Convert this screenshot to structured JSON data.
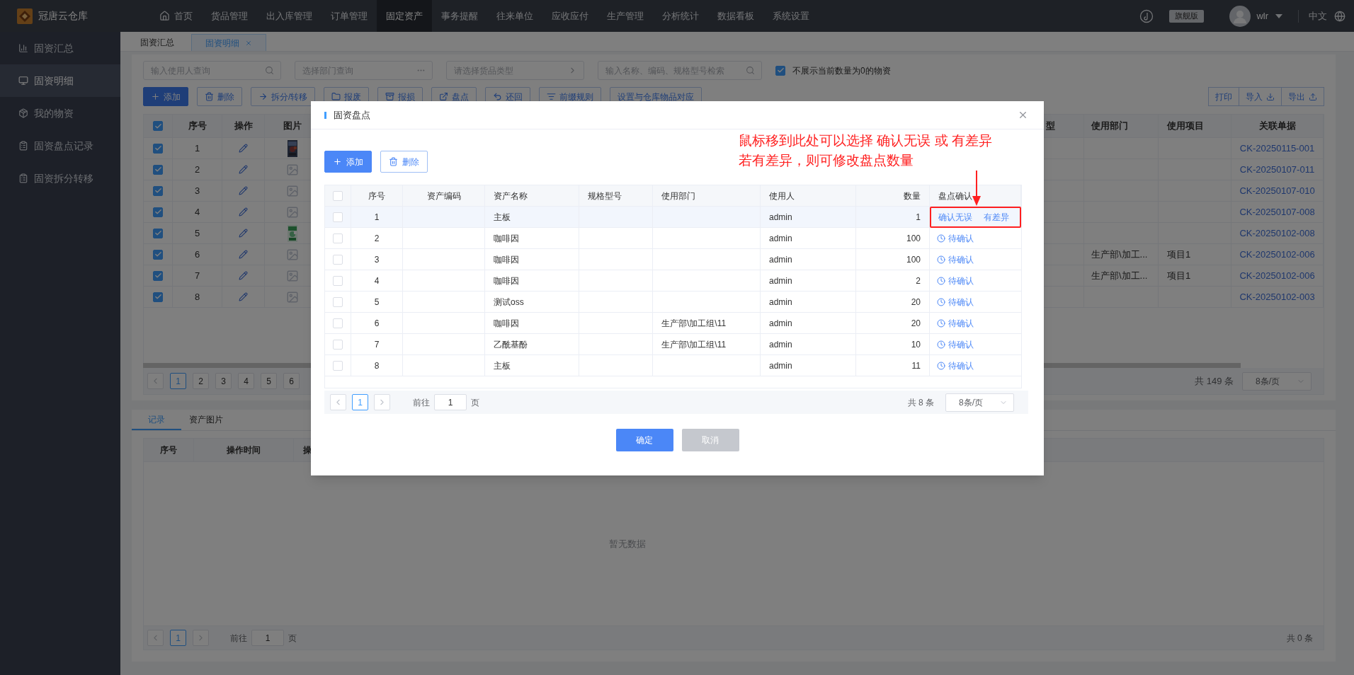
{
  "nav": {
    "brand": "冠唐云仓库",
    "items": [
      {
        "label": "首页",
        "selected": false,
        "kind": "home"
      },
      {
        "label": "货品管理",
        "selected": false
      },
      {
        "label": "出入库管理",
        "selected": false
      },
      {
        "label": "订单管理",
        "selected": false
      },
      {
        "label": "固定资产",
        "selected": true
      },
      {
        "label": "事务提醒",
        "selected": false
      },
      {
        "label": "往来单位",
        "selected": false
      },
      {
        "label": "应收应付",
        "selected": false
      },
      {
        "label": "生产管理",
        "selected": false
      },
      {
        "label": "分析统计",
        "selected": false
      },
      {
        "label": "数据看板",
        "selected": false
      },
      {
        "label": "系统设置",
        "selected": false
      }
    ],
    "edition": "旗舰版",
    "user": "wlr",
    "language": "中文"
  },
  "sidebar": {
    "items": [
      {
        "label": "固资汇总",
        "selected": false,
        "kind": "chart"
      },
      {
        "label": "固资明细",
        "selected": true,
        "kind": "monitor"
      },
      {
        "label": "我的物资",
        "selected": false,
        "kind": "package"
      },
      {
        "label": "固资盘点记录",
        "selected": false,
        "kind": "clipboard"
      },
      {
        "label": "固资拆分转移",
        "selected": false,
        "kind": "clipboard"
      }
    ]
  },
  "page_tabs": [
    {
      "label": "固资汇总",
      "selected": false,
      "closable": false
    },
    {
      "label": "固资明细",
      "selected": true,
      "closable": true
    }
  ],
  "filters": {
    "fields": [
      {
        "placeholder": "输入使用人查询",
        "kind": "search"
      },
      {
        "placeholder": "选择部门查询",
        "kind": "ellipsis"
      },
      {
        "placeholder": "请选择货品类型",
        "kind": "arrow"
      },
      {
        "placeholder": "输入名称、编码、规格型号检索",
        "kind": "search"
      }
    ],
    "hide_zero": {
      "label": "不展示当前数量为0的物资",
      "checked": true
    }
  },
  "toolbar": {
    "buttons": [
      {
        "label": "添加",
        "kind": "add"
      },
      {
        "label": "删除",
        "kind": "delete"
      },
      {
        "label": "拆分/转移",
        "kind": "split"
      },
      {
        "label": "报废",
        "kind": "scrap"
      },
      {
        "label": "报损",
        "kind": "loss"
      },
      {
        "label": "盘点",
        "kind": "count"
      },
      {
        "label": "还回",
        "kind": "return"
      },
      {
        "label": "前缀规则",
        "kind": "rule"
      },
      {
        "label": "设置与仓库物品对应",
        "kind": "plain"
      }
    ],
    "right_buttons": [
      {
        "label": "打印",
        "kind": "plain"
      },
      {
        "label": "导入",
        "kind": "import"
      },
      {
        "label": "导出",
        "kind": "export"
      }
    ]
  },
  "main_table": {
    "all_checked": true,
    "columns_left": [
      "序号",
      "操作",
      "图片"
    ],
    "columns_right": [
      "型",
      "使用部门",
      "使用项目",
      "关联单据"
    ],
    "rows": [
      {
        "checked": true,
        "no": "1",
        "document": "CK-20250115-001"
      },
      {
        "checked": true,
        "no": "2",
        "kind": "placeholder",
        "document": "CK-20250107-011"
      },
      {
        "checked": true,
        "no": "3",
        "kind": "placeholder",
        "document": "CK-20250107-010"
      },
      {
        "checked": true,
        "no": "4",
        "kind": "placeholder",
        "document": "CK-20250107-008"
      },
      {
        "checked": true,
        "no": "5",
        "document": "CK-20250102-008"
      },
      {
        "checked": true,
        "no": "6",
        "kind": "placeholder",
        "department": "生产部\\加工...",
        "project": "项目1",
        "document": "CK-20250102-006"
      },
      {
        "checked": true,
        "no": "7",
        "kind": "placeholder",
        "department": "生产部\\加工...",
        "project": "项目1",
        "document": "CK-20250102-006"
      },
      {
        "checked": true,
        "no": "8",
        "kind": "placeholder",
        "document": "CK-20250102-003"
      }
    ]
  },
  "main_pagination": {
    "pages": [
      {
        "label": "1",
        "selected": true
      },
      {
        "label": "2",
        "selected": false
      },
      {
        "label": "3",
        "selected": false
      },
      {
        "label": "4",
        "selected": false
      },
      {
        "label": "5",
        "selected": false
      },
      {
        "label": "6",
        "selected": false
      }
    ],
    "total": "共 149 条",
    "page_size": "8条/页"
  },
  "bottom": {
    "tabs": [
      {
        "label": "记录",
        "selected": true
      },
      {
        "label": "资产图片",
        "selected": false
      }
    ],
    "columns": [
      "序号",
      "操作时间",
      "操"
    ],
    "empty": "暂无数据",
    "pagination": {
      "pages": [
        {
          "label": "1",
          "selected": true
        }
      ],
      "goto_label": "前往",
      "goto_value": "1",
      "page_unit": "页",
      "total": "共 0 条"
    }
  },
  "dialog": {
    "title": "固资盘点",
    "buttons": [
      {
        "label": "添加",
        "kind": "add"
      },
      {
        "label": "删除",
        "kind": "delete"
      }
    ],
    "annotation": {
      "lines": [
        "鼠标移到此处可以选择 确认无误 或 有差异",
        "若有差异，则可修改盘点数量"
      ]
    },
    "table": {
      "all_checked": false,
      "columns": [
        "序号",
        "资产编码",
        "资产名称",
        "规格型号",
        "使用部门",
        "使用人",
        "数量",
        "盘点确认"
      ],
      "rows": [
        {
          "checked": false,
          "hovered": true,
          "no": "1",
          "name": "主板",
          "user": "admin",
          "quantity": "1",
          "confirm": {
            "kind": "choice",
            "options": [
              "确认无误",
              "有差异"
            ],
            "outlined": true
          }
        },
        {
          "checked": false,
          "hovered": false,
          "no": "2",
          "name": "咖啡因",
          "user": "admin",
          "quantity": "100",
          "confirm": {
            "kind": "pending",
            "label": "待确认"
          }
        },
        {
          "checked": false,
          "hovered": false,
          "no": "3",
          "name": "咖啡因",
          "user": "admin",
          "quantity": "100",
          "confirm": {
            "kind": "pending",
            "label": "待确认"
          }
        },
        {
          "checked": false,
          "hovered": false,
          "no": "4",
          "name": "咖啡因",
          "user": "admin",
          "quantity": "2",
          "confirm": {
            "kind": "pending",
            "label": "待确认"
          }
        },
        {
          "checked": false,
          "hovered": false,
          "no": "5",
          "name": "测试oss",
          "user": "admin",
          "quantity": "20",
          "confirm": {
            "kind": "pending",
            "label": "待确认"
          }
        },
        {
          "checked": false,
          "hovered": false,
          "no": "6",
          "name": "咖啡因",
          "department": "生产部\\加工组\\11",
          "user": "admin",
          "quantity": "20",
          "confirm": {
            "kind": "pending",
            "label": "待确认"
          }
        },
        {
          "checked": false,
          "hovered": false,
          "no": "7",
          "name": "乙酰基酚",
          "department": "生产部\\加工组\\11",
          "user": "admin",
          "quantity": "10",
          "confirm": {
            "kind": "pending",
            "label": "待确认"
          }
        },
        {
          "checked": false,
          "hovered": false,
          "no": "8",
          "name": "主板",
          "user": "admin",
          "quantity": "11",
          "confirm": {
            "kind": "pending",
            "label": "待确认"
          }
        }
      ]
    },
    "pagination": {
      "pages": [
        {
          "label": "1",
          "selected": true
        }
      ],
      "goto_label": "前往",
      "goto_value": "1",
      "page_unit": "页",
      "total": "共 8 条",
      "page_size": "8条/页"
    },
    "footer": [
      {
        "label": "确定",
        "kind": "primary"
      },
      {
        "label": "取消",
        "kind": "muted"
      }
    ]
  }
}
